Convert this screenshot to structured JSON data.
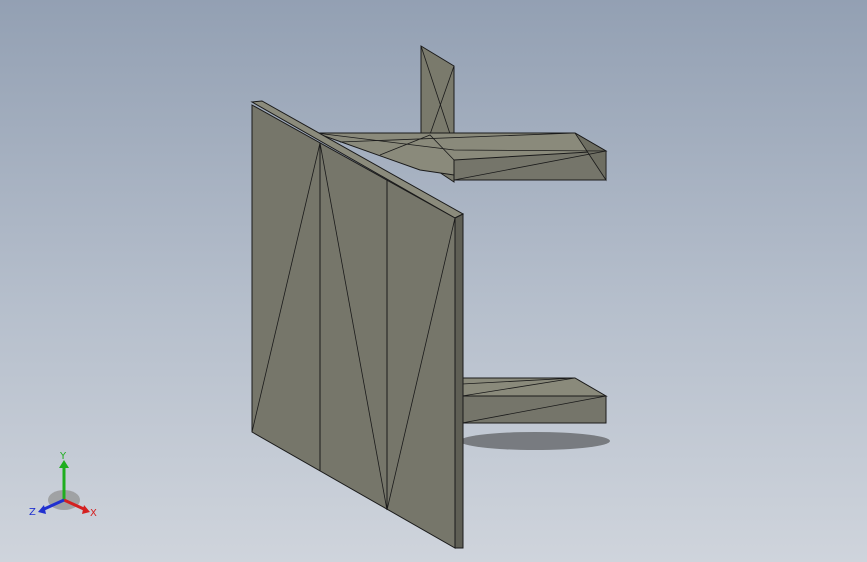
{
  "viewport": {
    "background_top": "#93a0b3",
    "background_bottom": "#cfd4dc"
  },
  "model": {
    "face_color": "#78786a",
    "face_dark": "#626257",
    "face_light": "#8d8d7e",
    "edge_color": "#1a1a1a"
  },
  "triad": {
    "x_label": "X",
    "y_label": "Y",
    "z_label": "Z",
    "x_color": "#d42020",
    "y_color": "#1fae1f",
    "z_color": "#2030d0"
  }
}
